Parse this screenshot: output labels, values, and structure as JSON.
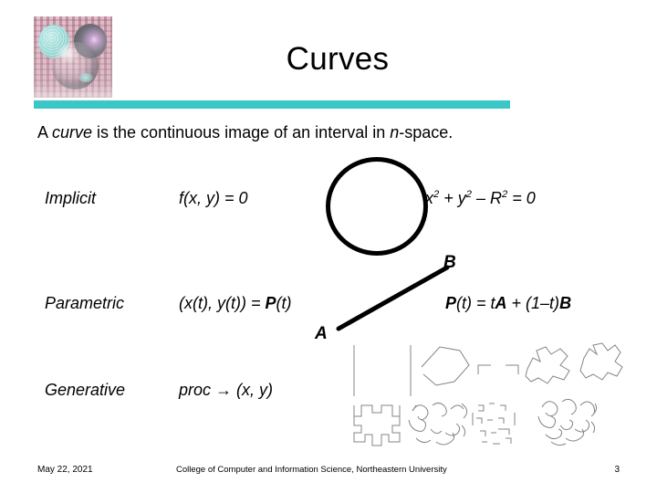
{
  "slide": {
    "title": "Curves",
    "subtitle": {
      "pre": "A ",
      "em1": "curve",
      "mid": " is the continuous image of an interval in ",
      "em2": "n",
      "post": "-space."
    },
    "accent_color": "#3bc7c7",
    "text_color": "#000000",
    "background_color": "#ffffff"
  },
  "decor": {
    "header_image_name": "spheres-on-circuit-board-decorative-image"
  },
  "representations": [
    {
      "label": "Implicit",
      "formula": "f(x, y) = 0",
      "example": {
        "t1": "x",
        "s1": "2",
        "t2": " + y",
        "s2": "2",
        "t3": " – R",
        "s3": "2",
        "t4": " = 0"
      },
      "figure": "circle-outline"
    },
    {
      "label": "Parametric",
      "formula": {
        "plain1": "(x(t), y(t)) = ",
        "bold1": "P",
        "plain2": "(t)"
      },
      "example": {
        "bold1": "P",
        "plain1": "(t) = t",
        "bold2": "A",
        "plain2": " + (1–t)",
        "bold3": "B"
      },
      "figure": "line-segment-ab",
      "figure_labels": {
        "a": "A",
        "b": "B"
      }
    },
    {
      "label": "Generative",
      "formula": {
        "plain1": "proc ",
        "arrow": "→",
        "plain2": " (x, y)"
      },
      "figure": "fractal-iterations"
    }
  ],
  "footer": {
    "date": "May 22, 2021",
    "center": "College of Computer and Information Science, Northeastern University",
    "page_number": "3"
  }
}
